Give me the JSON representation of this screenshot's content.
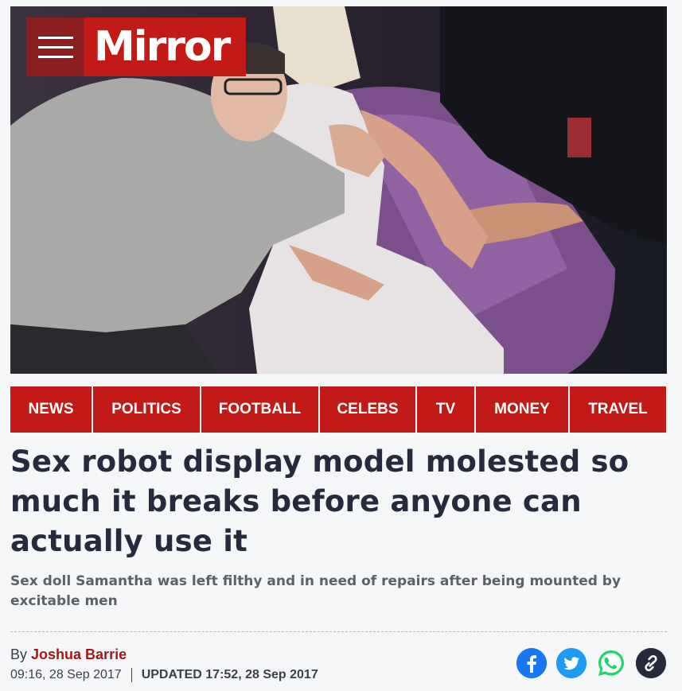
{
  "header": {
    "logo_text": "Mirror",
    "menu_icon": "hamburger-menu-icon",
    "brand_color": "#c21b17",
    "menu_bg_color": "#8c1f1f"
  },
  "nav": {
    "items": [
      {
        "label": "NEWS"
      },
      {
        "label": "POLITICS"
      },
      {
        "label": "FOOTBALL"
      },
      {
        "label": "CELEBS"
      },
      {
        "label": "TV"
      },
      {
        "label": "MONEY"
      },
      {
        "label": "TRAVEL"
      }
    ]
  },
  "article": {
    "headline": "Sex robot display model molested so much it breaks before anyone can actually use it",
    "standfirst": "Sex doll Samantha was left filthy and in need of repairs after being mounted by excitable men",
    "byline_prefix": "By",
    "author": "Joshua Barrie",
    "published": "09:16, 28 Sep 2017",
    "updated": "UPDATED 17:52, 28 Sep 2017"
  },
  "share": {
    "buttons": [
      {
        "icon": "facebook-icon",
        "color": "#1877f2"
      },
      {
        "icon": "twitter-icon",
        "color": "#1d9bf0"
      },
      {
        "icon": "whatsapp-icon",
        "color": "#25d366"
      },
      {
        "icon": "link-icon",
        "color": "#252a3c"
      }
    ]
  }
}
